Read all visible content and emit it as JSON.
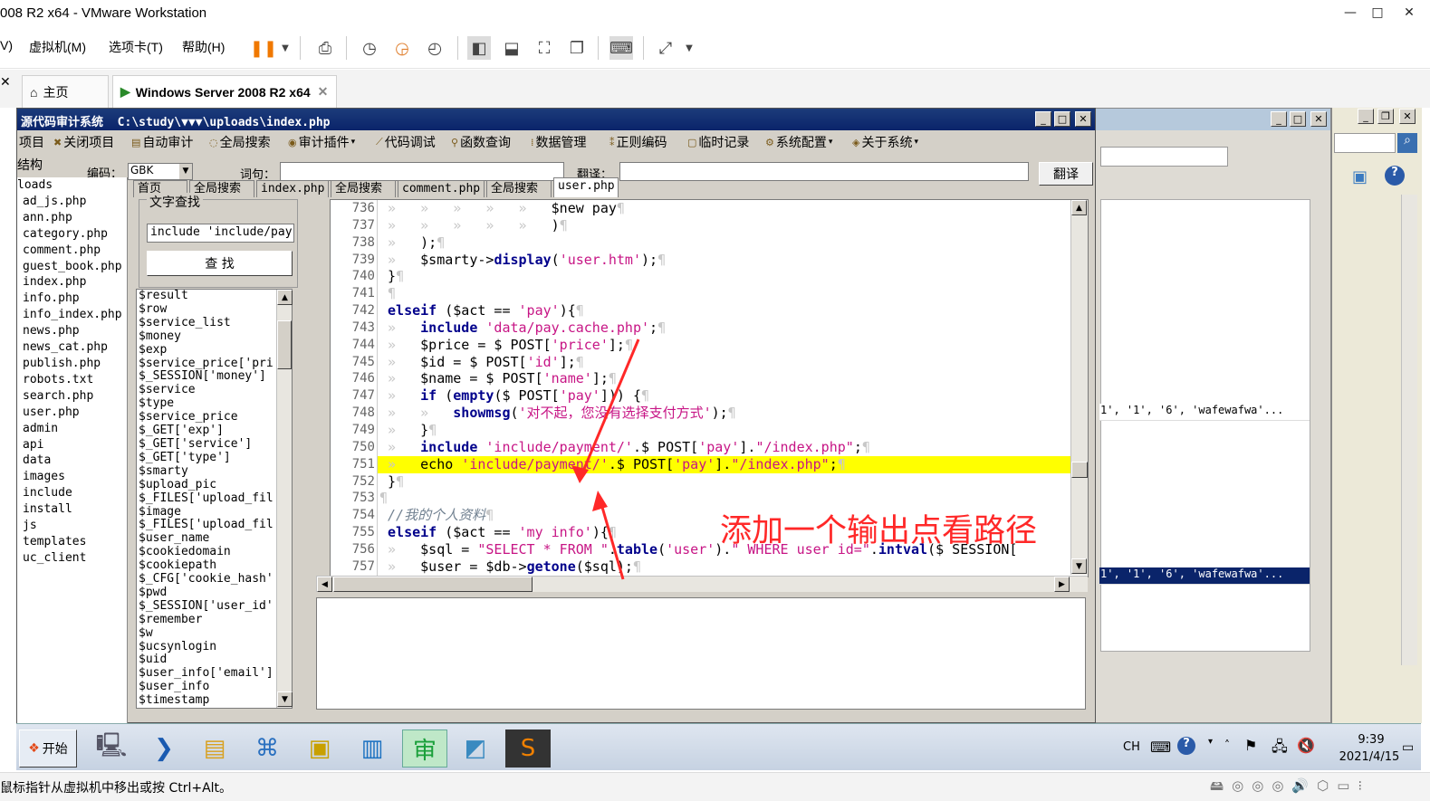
{
  "vmware": {
    "title": "008 R2 x64 - VMware Workstation",
    "window_controls": [
      "—",
      "□",
      "✕"
    ],
    "menu": [
      "V)",
      "虚拟机(M)",
      "选项卡(T)",
      "帮助(H)"
    ],
    "tabs": [
      {
        "label": "主页",
        "icon": "home-icon"
      },
      {
        "label": "Windows Server 2008 R2 x64",
        "icon": "vm-icon"
      }
    ],
    "status_text": "鼠标指针从虚拟机中移出或按 Ctrl+Alt。"
  },
  "app": {
    "title": "源代码审计系统",
    "path": "C:\\study\\▼▼▼\\uploads\\index.php",
    "menu": [
      "项目",
      "关闭项目",
      "自动审计",
      "全局搜索",
      "审计插件",
      "代码调试",
      "函数查询",
      "数据管理",
      "正则编码",
      "临时记录",
      "系统配置",
      "关于系统"
    ],
    "tree_label": "结构",
    "encoding_label": "编码：",
    "encoding_value": "GBK",
    "word_label": "词句：",
    "translate_label": "翻译：",
    "translate_button": "翻译",
    "tabs": [
      "首页",
      "全局搜索",
      "index.php",
      "全局搜索",
      "comment.php",
      "全局搜索",
      "user.php"
    ],
    "search_group_label": "文字查找",
    "search_value": "include 'include/pay",
    "search_button": "查 找"
  },
  "file_tree": [
    "loads",
    "ad_js.php",
    "ann.php",
    "category.php",
    "comment.php",
    "guest_book.php",
    "index.php",
    "info.php",
    "info_index.php",
    "news.php",
    "news_cat.php",
    "publish.php",
    "robots.txt",
    "search.php",
    "user.php",
    "admin",
    "api",
    "data",
    "images",
    "include",
    "install",
    "js",
    "templates",
    "uc_client"
  ],
  "variables": [
    "$result",
    "$row",
    "$service_list",
    "$money",
    "$exp",
    "$service_price['pri",
    "$_SESSION['money']",
    "$service",
    "$type",
    "$service_price",
    "$_GET['exp']",
    "$_GET['service']",
    "$_GET['type']",
    "$smarty",
    "$upload_pic",
    "$_FILES['upload_fil",
    "$image",
    "$_FILES['upload_fil",
    "$user_name",
    "$cookiedomain",
    "$cookiepath",
    "$_CFG['cookie_hash'",
    "$pwd",
    "$_SESSION['user_id'",
    "$remember",
    "$w",
    "$ucsynlogin",
    "$uid",
    "$user_info['email']",
    "$user_info",
    "$timestamp"
  ],
  "code": {
    "line_numbers": [
      "736",
      "737",
      "738",
      "739",
      "740",
      "741",
      "742",
      "743",
      "744",
      "745",
      "746",
      "747",
      "748",
      "749",
      "750",
      "751",
      "752",
      "753",
      "754",
      "755",
      "756",
      "757"
    ],
    "highlight_line": "751",
    "lines": [
      [
        {
          "t": "ws",
          "v": " »   »   »   »   »   "
        },
        {
          "t": "n",
          "v": "$new pay"
        },
        {
          "t": "ws",
          "v": "¶"
        }
      ],
      [
        {
          "t": "ws",
          "v": " »   »   »   »   »   "
        },
        {
          "t": "n",
          "v": ")"
        },
        {
          "t": "ws",
          "v": "¶"
        }
      ],
      [
        {
          "t": "ws",
          "v": " »   "
        },
        {
          "t": "n",
          "v": ");"
        },
        {
          "t": "ws",
          "v": "¶"
        }
      ],
      [
        {
          "t": "ws",
          "v": " »   "
        },
        {
          "t": "n",
          "v": "$smarty->"
        },
        {
          "t": "kw",
          "v": "display"
        },
        {
          "t": "n",
          "v": "("
        },
        {
          "t": "str",
          "v": "'user.htm'"
        },
        {
          "t": "n",
          "v": ");"
        },
        {
          "t": "ws",
          "v": "¶"
        }
      ],
      [
        {
          "t": "ws",
          "v": " "
        },
        {
          "t": "n",
          "v": "}"
        },
        {
          "t": "ws",
          "v": "¶"
        }
      ],
      [
        {
          "t": "ws",
          "v": " ¶"
        }
      ],
      [
        {
          "t": "n",
          "v": " "
        },
        {
          "t": "kw",
          "v": "elseif"
        },
        {
          "t": "n",
          "v": " ($act == "
        },
        {
          "t": "str",
          "v": "'pay'"
        },
        {
          "t": "n",
          "v": "){"
        },
        {
          "t": "ws",
          "v": "¶"
        }
      ],
      [
        {
          "t": "ws",
          "v": " »   "
        },
        {
          "t": "kw",
          "v": "include"
        },
        {
          "t": "n",
          "v": " "
        },
        {
          "t": "str",
          "v": "'data/pay.cache.php'"
        },
        {
          "t": "n",
          "v": ";"
        },
        {
          "t": "ws",
          "v": "¶"
        }
      ],
      [
        {
          "t": "ws",
          "v": " »   "
        },
        {
          "t": "n",
          "v": "$price = $ POST["
        },
        {
          "t": "str",
          "v": "'price'"
        },
        {
          "t": "n",
          "v": "];"
        },
        {
          "t": "ws",
          "v": "¶"
        }
      ],
      [
        {
          "t": "ws",
          "v": " »   "
        },
        {
          "t": "n",
          "v": "$id = $ POST["
        },
        {
          "t": "str",
          "v": "'id'"
        },
        {
          "t": "n",
          "v": "];"
        },
        {
          "t": "ws",
          "v": "¶"
        }
      ],
      [
        {
          "t": "ws",
          "v": " »   "
        },
        {
          "t": "n",
          "v": "$name = $ POST["
        },
        {
          "t": "str",
          "v": "'name'"
        },
        {
          "t": "n",
          "v": "];"
        },
        {
          "t": "ws",
          "v": "¶"
        }
      ],
      [
        {
          "t": "ws",
          "v": " »   "
        },
        {
          "t": "kw",
          "v": "if"
        },
        {
          "t": "n",
          "v": " ("
        },
        {
          "t": "kw",
          "v": "empty"
        },
        {
          "t": "n",
          "v": "($ POST["
        },
        {
          "t": "str",
          "v": "'pay'"
        },
        {
          "t": "n",
          "v": "])) {"
        },
        {
          "t": "ws",
          "v": "¶"
        }
      ],
      [
        {
          "t": "ws",
          "v": " »   »   "
        },
        {
          "t": "kw",
          "v": "showmsg"
        },
        {
          "t": "n",
          "v": "("
        },
        {
          "t": "str",
          "v": "'对不起，您没有选择支付方式'"
        },
        {
          "t": "n",
          "v": ");"
        },
        {
          "t": "ws",
          "v": "¶"
        }
      ],
      [
        {
          "t": "ws",
          "v": " »   "
        },
        {
          "t": "n",
          "v": "}"
        },
        {
          "t": "ws",
          "v": "¶"
        }
      ],
      [
        {
          "t": "ws",
          "v": " »   "
        },
        {
          "t": "kw",
          "v": "include"
        },
        {
          "t": "n",
          "v": " "
        },
        {
          "t": "str",
          "v": "'include/payment/'"
        },
        {
          "t": "n",
          "v": ".$ POST["
        },
        {
          "t": "str",
          "v": "'pay'"
        },
        {
          "t": "n",
          "v": "]."
        },
        {
          "t": "str",
          "v": "\"/index.php\""
        },
        {
          "t": "n",
          "v": ";"
        },
        {
          "t": "ws",
          "v": "¶"
        }
      ],
      [
        {
          "t": "ws",
          "v": " »   "
        },
        {
          "t": "n",
          "v": "echo "
        },
        {
          "t": "str",
          "v": "'include/payment/'"
        },
        {
          "t": "n",
          "v": ".$ POST["
        },
        {
          "t": "str",
          "v": "'pay'"
        },
        {
          "t": "n",
          "v": "]."
        },
        {
          "t": "str",
          "v": "\"/index.php\""
        },
        {
          "t": "n",
          "v": ";"
        },
        {
          "t": "ws",
          "v": "¶"
        }
      ],
      [
        {
          "t": "ws",
          "v": " "
        },
        {
          "t": "n",
          "v": "}"
        },
        {
          "t": "ws",
          "v": "¶"
        }
      ],
      [
        {
          "t": "ws",
          "v": "¶"
        }
      ],
      [
        {
          "t": "n",
          "v": " "
        },
        {
          "t": "cmt",
          "v": "//我的个人资料"
        },
        {
          "t": "ws",
          "v": "¶"
        }
      ],
      [
        {
          "t": "n",
          "v": " "
        },
        {
          "t": "kw",
          "v": "elseif"
        },
        {
          "t": "n",
          "v": " ($act == "
        },
        {
          "t": "str",
          "v": "'my info'"
        },
        {
          "t": "n",
          "v": "){"
        },
        {
          "t": "ws",
          "v": "¶"
        }
      ],
      [
        {
          "t": "ws",
          "v": " »   "
        },
        {
          "t": "n",
          "v": "$sql = "
        },
        {
          "t": "str",
          "v": "\"SELECT * FROM \""
        },
        {
          "t": "n",
          "v": "."
        },
        {
          "t": "kw",
          "v": "table"
        },
        {
          "t": "n",
          "v": "("
        },
        {
          "t": "str",
          "v": "'user'"
        },
        {
          "t": "n",
          "v": ")."
        },
        {
          "t": "str",
          "v": "\" WHERE user id=\""
        },
        {
          "t": "n",
          "v": "."
        },
        {
          "t": "kw",
          "v": "intval"
        },
        {
          "t": "n",
          "v": "($ SESSION["
        }
      ],
      [
        {
          "t": "ws",
          "v": " »   "
        },
        {
          "t": "n",
          "v": "$user = $db->"
        },
        {
          "t": "kw",
          "v": "getone"
        },
        {
          "t": "n",
          "v": "($sql);"
        },
        {
          "t": "ws",
          "v": "¶"
        }
      ]
    ]
  },
  "annotation": "添加一个输出点看路径",
  "background_grid": {
    "row1": "1', '1', '6', 'wafewafwa'...",
    "row2": "1', '1', '6', 'wafewafwa'..."
  },
  "taskbar": {
    "start_label": "开始",
    "lang": "CH",
    "time": "9:39",
    "date": "2021/4/15"
  },
  "colors": {
    "annotation": "#ff2828",
    "highlight": "#ffff00",
    "titlebar": "#0a246a"
  }
}
